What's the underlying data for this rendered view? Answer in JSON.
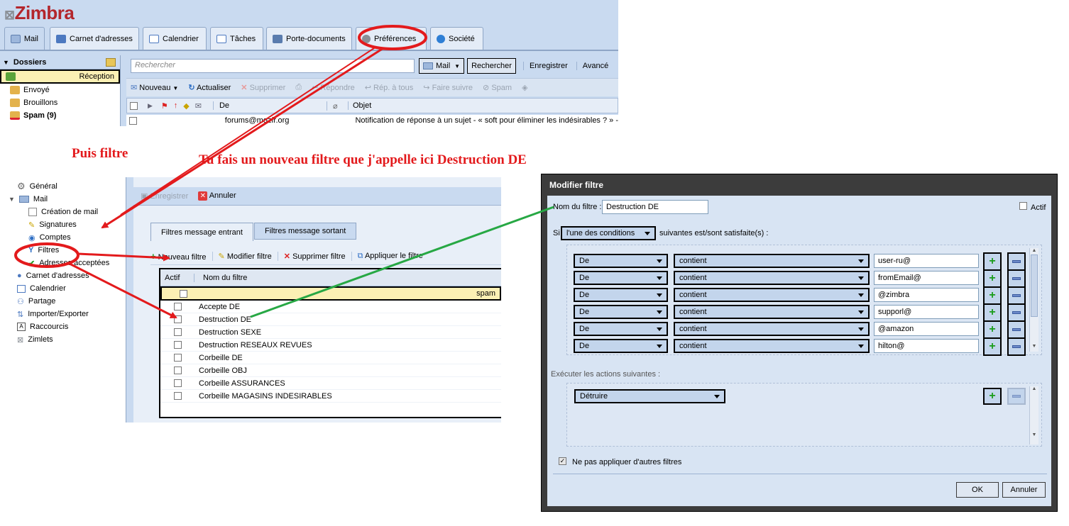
{
  "zimbra": {
    "logo": "Zimbra",
    "tabs": [
      "Mail",
      "Carnet d'adresses",
      "Calendrier",
      "Tâches",
      "Porte-documents",
      "Préférences",
      "Société"
    ],
    "folders_header": "Dossiers",
    "folders": [
      "Réception",
      "Envoyé",
      "Brouillons",
      "Spam (9)"
    ],
    "search_placeholder": "Rechercher",
    "search_scope": "Mail",
    "search_button": "Rechercher",
    "save_search": "Enregistrer",
    "advanced": "Avancé",
    "toolbar": [
      "Nouveau",
      "Actualiser",
      "Supprimer",
      "Répondre",
      "Rép. à tous",
      "Faire suivre",
      "Spam"
    ],
    "col_from": "De",
    "col_subject": "Objet",
    "row_from": "forums@mozfr.org",
    "row_subject": "Notification de réponse à un sujet - « soft pour éliminer les indésirables ? » -"
  },
  "annotations": {
    "then_filter": "Puis filtre",
    "new_filter": "Tu fais un nouveau filtre que j'appelle ici Destruction DE"
  },
  "prefs": {
    "nav": [
      {
        "label": "Général",
        "level": 0
      },
      {
        "label": "Mail",
        "level": 0
      },
      {
        "label": "Création de mail",
        "level": 1
      },
      {
        "label": "Signatures",
        "level": 1
      },
      {
        "label": "Comptes",
        "level": 1
      },
      {
        "label": "Filtres",
        "level": 1
      },
      {
        "label": "Adresses acceptées",
        "level": 1
      },
      {
        "label": "Carnet d'adresses",
        "level": 0
      },
      {
        "label": "Calendrier",
        "level": 0
      },
      {
        "label": "Partage",
        "level": 0
      },
      {
        "label": "Importer/Exporter",
        "level": 0
      },
      {
        "label": "Raccourcis",
        "level": 0
      },
      {
        "label": "Zimlets",
        "level": 0
      }
    ],
    "save": "Enregistrer",
    "cancel": "Annuler",
    "tab_in": "Filtres message entrant",
    "tab_out": "Filtres message sortant",
    "new_filter": "Nouveau filtre",
    "edit_filter": "Modifier filtre",
    "delete_filter": "Supprimer filtre",
    "apply_filter": "Appliquer le filtre",
    "col_active": "Actif",
    "col_name": "Nom du filtre",
    "filters": [
      "spam",
      "Accepte DE",
      "Destruction DE",
      "Destruction SEXE",
      "Destruction RESEAUX REVUES",
      "Corbeille DE",
      "Corbeille OBJ",
      "Corbeille ASSURANCES",
      "Corbeille MAGASINS INDESIRABLES"
    ]
  },
  "dialog": {
    "title": "Modifier filtre",
    "name_label": "Nom du filtre :",
    "name_value": "Destruction DE",
    "active_label": "Actif",
    "if_label": "Si",
    "condition_mode": "l'une des conditions",
    "condition_suffix": "suivantes est/sont satisfaite(s) :",
    "conditions": [
      {
        "field": "De",
        "op": "contient",
        "value": "user-ru@"
      },
      {
        "field": "De",
        "op": "contient",
        "value": "fromEmail@"
      },
      {
        "field": "De",
        "op": "contient",
        "value": "@zimbra"
      },
      {
        "field": "De",
        "op": "contient",
        "value": "supporl@"
      },
      {
        "field": "De",
        "op": "contient",
        "value": "@amazon"
      },
      {
        "field": "De",
        "op": "contient",
        "value": "hilton@"
      }
    ],
    "actions_label": "Exécuter les actions suivantes :",
    "action": "Détruire",
    "stop_label": "Ne pas appliquer d'autres filtres",
    "ok": "OK",
    "cancel": "Annuler"
  },
  "colors": {
    "annotation": "#e31a1c",
    "arrow_green": "#27a844",
    "zimbra_blue": "#c9daf0"
  }
}
